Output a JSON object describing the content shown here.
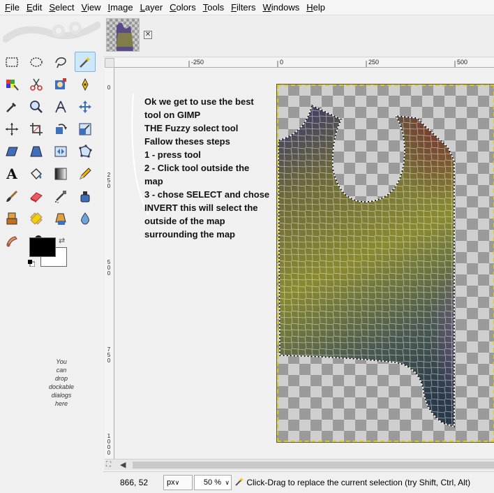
{
  "menubar": {
    "items": [
      "File",
      "Edit",
      "Select",
      "View",
      "Image",
      "Layer",
      "Colors",
      "Tools",
      "Filters",
      "Windows",
      "Help"
    ]
  },
  "toolbox": {
    "tools": [
      "rect-select-icon",
      "ellipse-select-icon",
      "free-select-icon",
      "fuzzy-select-icon",
      "select-by-color-icon",
      "scissors-select-icon",
      "foreground-select-icon",
      "paths-icon",
      "color-picker-icon",
      "zoom-icon",
      "measure-icon",
      "move-icon",
      "align-icon",
      "crop-icon",
      "rotate-icon",
      "scale-icon",
      "shear-icon",
      "perspective-icon",
      "flip-icon",
      "cage-transform-icon",
      "text-icon",
      "bucket-fill-icon",
      "blend-icon",
      "pencil-icon",
      "paintbrush-icon",
      "eraser-icon",
      "airbrush-icon",
      "ink-icon",
      "clone-icon",
      "heal-icon",
      "perspective-clone-icon",
      "blur-icon",
      "smudge-icon",
      "dodge-burn-icon"
    ],
    "active_tool": "fuzzy-select-icon",
    "foreground_color": "#000000",
    "background_color": "#ffffff",
    "dock_hint": [
      "You",
      "can",
      "drop",
      "dockable",
      "dialogs",
      "here"
    ]
  },
  "ruler": {
    "top_labels": [
      "-250",
      "0",
      "250",
      "500"
    ],
    "left_labels": [
      "0",
      "250",
      "500",
      "750",
      "1000"
    ]
  },
  "canvas": {
    "annotation_lines": [
      "Ok we get to use the best",
      "tool on GIMP",
      "THE Fuzzy solect tool",
      "Fallow theses steps",
      "1 - press tool",
      "2 - Click tool outside the",
      "map",
      "3 - chose SELECT and chose",
      "INVERT this will select the",
      "outside of the map",
      "surrounding the map"
    ],
    "selection_color": "#e0d000"
  },
  "statusbar": {
    "coords": "866, 52",
    "unit": "px",
    "zoom": "50 %",
    "message": "Click-Drag to replace the current selection (try Shift, Ctrl, Alt)"
  }
}
